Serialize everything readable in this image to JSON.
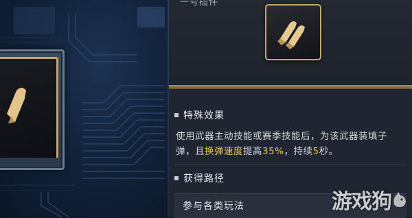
{
  "header": {
    "title": "一号插件"
  },
  "item": {
    "icon": "twin-bullets-icon"
  },
  "special_effect": {
    "title": "特殊效果",
    "desc_part1": "使用武器主动技能或赛季技能后，为该武器装填子弹，且",
    "desc_highlight_label": "换弹速度",
    "desc_part2": "提高",
    "desc_highlight_value": "35%",
    "desc_part3": "，持续",
    "desc_highlight_duration": "5",
    "desc_part4": "秒。"
  },
  "acquire": {
    "title": "获得路径",
    "route": "参与各类玩法"
  },
  "watermark": {
    "text": "游戏狗"
  },
  "colors": {
    "accent_gold": "#c7a86a",
    "highlight_yellow": "#e8c65a",
    "panel_bg": "#1f2531"
  }
}
